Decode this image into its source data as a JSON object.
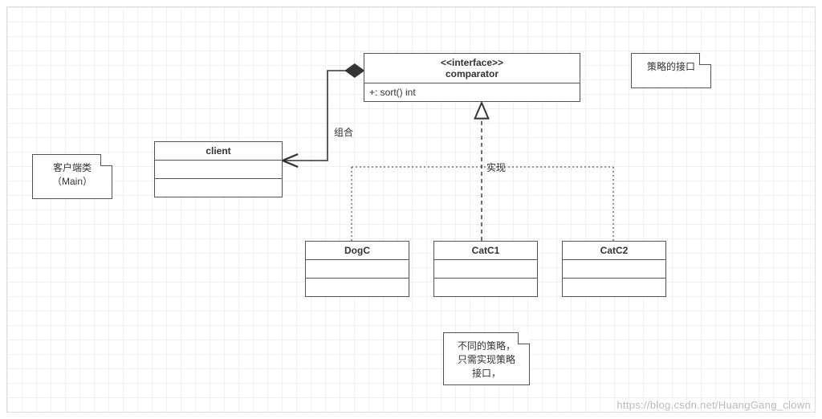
{
  "interface": {
    "stereotype": "<<interface>>",
    "name": "comparator",
    "method": "+: sort() int"
  },
  "client": {
    "name": "client"
  },
  "impl": {
    "dog": "DogC",
    "cat1": "CatC1",
    "cat2": "CatC2"
  },
  "notes": {
    "clientNote": {
      "line1": "客户端类",
      "line2": "（Main）"
    },
    "interfaceNote": "策略的接口",
    "implNote": {
      "l1": "不同的策略，",
      "l2": "只需实现策略",
      "l3": "接口，"
    }
  },
  "labels": {
    "compose": "组合",
    "realize": "实现"
  },
  "watermark": "https://blog.csdn.net/HuangGang_clown"
}
